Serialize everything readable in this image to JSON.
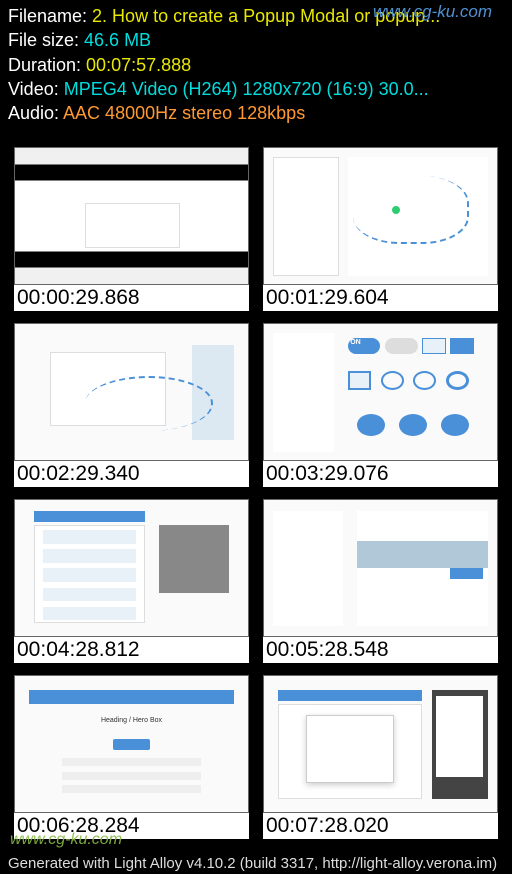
{
  "watermark_top": "www.cg-ku.com",
  "watermark_bottom": "www.cg-ku.com",
  "info": {
    "filename_label": "Filename: ",
    "filename_value": "2. How to create a Popup Modal or popup...",
    "filesize_label": "File size: ",
    "filesize_value": "46.6 MB",
    "duration_label": "Duration: ",
    "duration_value": "00:07:57.888",
    "video_label": "Video: ",
    "video_value": "MPEG4 Video (H264) 1280x720 (16:9) 30.0...",
    "audio_label": "Audio: ",
    "audio_value": "AAC 48000Hz stereo 128kbps"
  },
  "thumbs": [
    {
      "ts": "00:00:29.868"
    },
    {
      "ts": "00:01:29.604"
    },
    {
      "ts": "00:02:29.340"
    },
    {
      "ts": "00:03:29.076"
    },
    {
      "ts": "00:04:28.812"
    },
    {
      "ts": "00:05:28.548"
    },
    {
      "ts": "00:06:28.284"
    },
    {
      "ts": "00:07:28.020"
    }
  ],
  "toggle_on": "ON",
  "hero_text": "Heading / Hero Box",
  "footer": "Generated with Light Alloy v4.10.2 (build 3317, http://light-alloy.verona.im)"
}
